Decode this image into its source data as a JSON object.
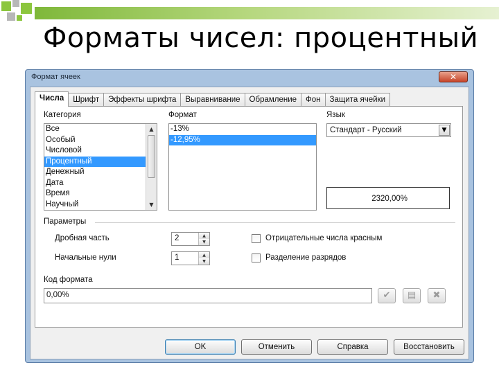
{
  "slide": {
    "title": "Форматы чисел: процентный",
    "colors": {
      "accent_green": "#7fb83a",
      "square_green": "#8cc63e",
      "square_gray": "#b7b7b7"
    }
  },
  "dialog": {
    "title": "Формат ячеек",
    "close_icon": "close-icon",
    "tabs": [
      {
        "label": "Числа",
        "active": true
      },
      {
        "label": "Шрифт"
      },
      {
        "label": "Эффекты шрифта"
      },
      {
        "label": "Выравнивание"
      },
      {
        "label": "Обрамление"
      },
      {
        "label": "Фон"
      },
      {
        "label": "Защита ячейки"
      }
    ],
    "category": {
      "label": "Категория",
      "items": [
        "Все",
        "Особый",
        "Числовой",
        "Процентный",
        "Денежный",
        "Дата",
        "Время",
        "Научный"
      ],
      "selected": "Процентный"
    },
    "format": {
      "label": "Формат",
      "items": [
        "-13%",
        "-12,95%"
      ],
      "selected": "-12,95%"
    },
    "language": {
      "label": "Язык",
      "value": "Стандарт - Русский"
    },
    "preview": {
      "value": "2320,00%"
    },
    "parameters": {
      "label": "Параметры",
      "decimal_label": "Дробная часть",
      "decimal_value": "2",
      "leading_zeros_label": "Начальные нули",
      "leading_zeros_value": "1",
      "negative_red_label": "Отрицательные числа красным",
      "negative_red_checked": false,
      "thousands_sep_label": "Разделение разрядов",
      "thousands_sep_checked": false
    },
    "format_code": {
      "label": "Код формата",
      "value": "0,00%"
    },
    "buttons": {
      "ok": "OK",
      "cancel": "Отменить",
      "help": "Справка",
      "reset": "Восстановить"
    }
  }
}
